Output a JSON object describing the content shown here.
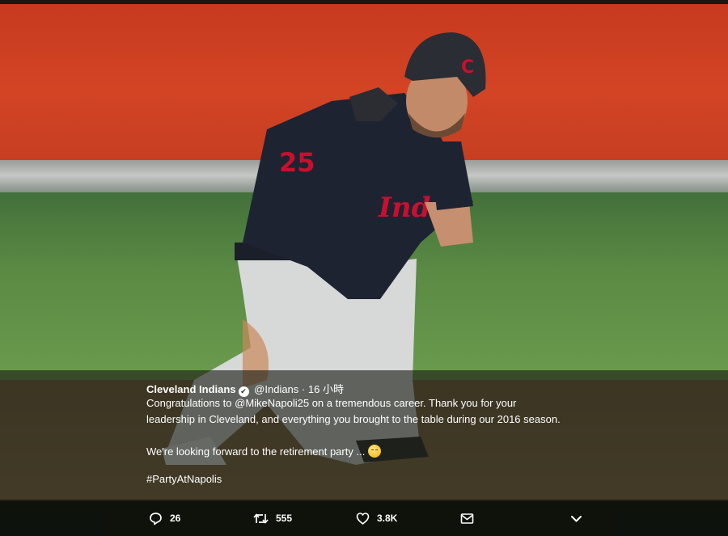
{
  "tweet": {
    "author_name": "Cleveland Indians",
    "handle": "@Indians",
    "separator": "·",
    "time": "16 小時",
    "line1_pre": "Congratulations to ",
    "mention": "@MikeNapoli25",
    "line1_post": " on a tremendous career. Thank you for your",
    "line2": "leadership in Cleveland, and everything you brought to the table during our 2016 season.",
    "line3": "We're looking forward to the retirement party ... ",
    "hashtag": "#PartyAtNapolis"
  },
  "actions": {
    "replies": "26",
    "retweets": "555",
    "likes": "3.8K"
  },
  "icons": {
    "reply": "reply-icon",
    "retweet": "retweet-icon",
    "like": "heart-icon",
    "message": "envelope-icon",
    "more": "chevron-down-icon",
    "verified": "verified-icon",
    "emoji": "smirking-face-icon"
  },
  "colors": {
    "overlay": "#1c2416",
    "text": "#ffffff",
    "wall": "#d24424",
    "grass": "#5b8a44"
  }
}
